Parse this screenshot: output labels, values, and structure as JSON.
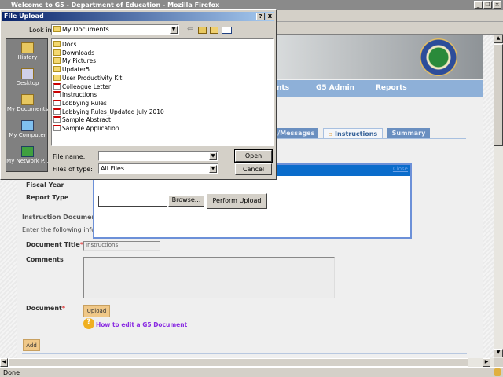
{
  "browser": {
    "title": "Welcome to G5 - Department of Education - Mozilla Firefox",
    "status": "Done"
  },
  "nav": {
    "items": [
      "nts",
      "G5 Admin",
      "Reports"
    ]
  },
  "tabs": [
    {
      "label": "ts/Messages"
    },
    {
      "label": "Instructions",
      "active": true
    },
    {
      "label": "Summary"
    }
  ],
  "form": {
    "fiscal_year_label": "Fiscal Year",
    "report_type_label": "Report Type",
    "section_title": "Instruction Document",
    "intro": "Enter the following inform",
    "doc_title_label": "Document Title",
    "doc_title_value": "Instructions",
    "comments_label": "Comments",
    "document_label": "Document",
    "required": "*",
    "upload_label": "Upload",
    "help_link": "How to edit a G5 Document",
    "add_label": "Add"
  },
  "overlay": {
    "close": "Close",
    "browse": "Browse...",
    "perform": "Perform Upload",
    "file_value": ""
  },
  "dialog": {
    "title": "File Upload",
    "help": "?",
    "close": "X",
    "look_in_label": "Look in:",
    "look_in_value": "My Documents",
    "places": [
      "History",
      "Desktop",
      "My Documents",
      "My Computer",
      "My Network P..."
    ],
    "files": [
      {
        "name": "Docs",
        "type": "folder"
      },
      {
        "name": "Downloads",
        "type": "folder"
      },
      {
        "name": "My Pictures",
        "type": "folder"
      },
      {
        "name": "Updater5",
        "type": "folder"
      },
      {
        "name": "User Productivity Kit",
        "type": "folder"
      },
      {
        "name": "Colleague Letter",
        "type": "pdf"
      },
      {
        "name": "Instructions",
        "type": "pdf"
      },
      {
        "name": "Lobbying Rules",
        "type": "pdf"
      },
      {
        "name": "Lobbying Rules_Updated July 2010",
        "type": "pdf"
      },
      {
        "name": "Sample Abstract",
        "type": "pdf"
      },
      {
        "name": "Sample Application",
        "type": "pdf"
      }
    ],
    "file_name_label": "File name:",
    "file_name_value": "",
    "file_type_label": "Files of type:",
    "file_type_value": "All Files",
    "open": "Open",
    "cancel": "Cancel"
  },
  "colors": {
    "nav": "#8eb0d8",
    "overlay_header": "#0a6ccb",
    "upload_button": "#f0c888"
  }
}
